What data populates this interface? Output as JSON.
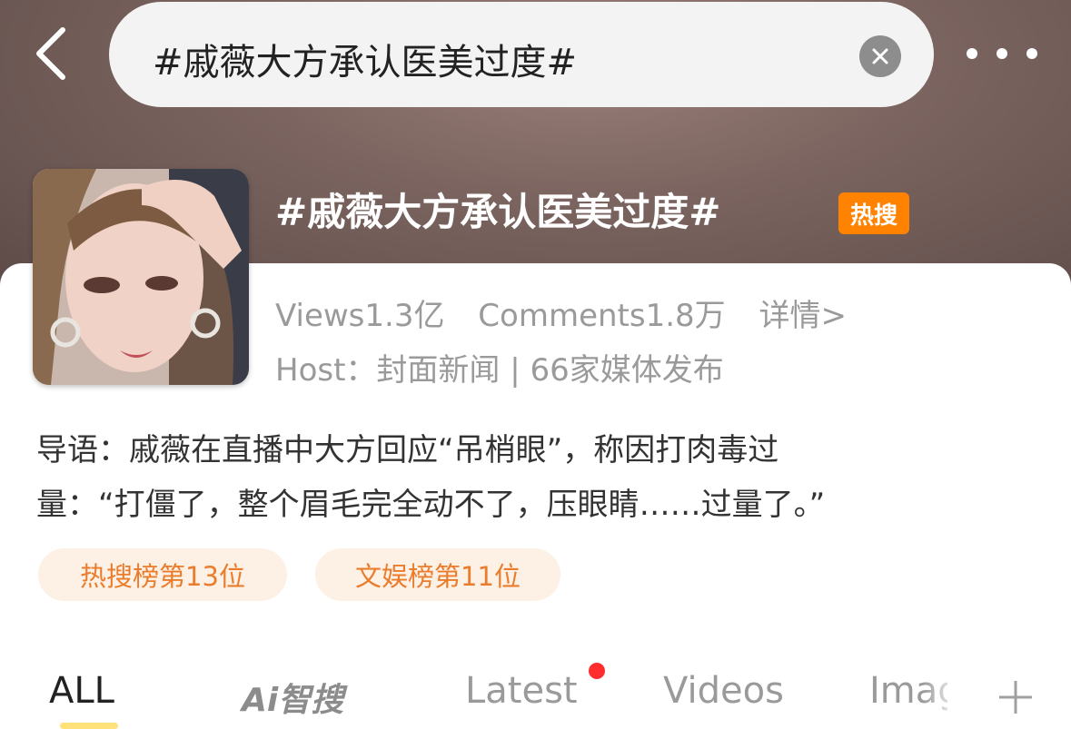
{
  "header": {
    "search_text": "#戚薇大方承认医美过度#",
    "icons": {
      "back": "back-chevron-icon",
      "clear": "clear-x-icon",
      "more": "more-dots-icon"
    }
  },
  "topic": {
    "title": "#戚薇大方承认医美过度#",
    "hot_badge": "热搜",
    "hot_badge_color": "#ff8200",
    "views": "Views1.3亿",
    "comments": "Comments1.8万",
    "details_link": "详情>",
    "host_line": "Host：封面新闻 | 66家媒体发布",
    "intro_line1": "导语：戚薇在直播中大方回应“吊梢眼”，称因打肉毒过",
    "intro_line2": "量：“打僵了，整个眉毛完全动不了，压眼睛……过量了。”",
    "rank_hot": "热搜榜第13位",
    "rank_ent": "文娱榜第11位"
  },
  "tabs": {
    "all": "ALL",
    "ai": "Ai智搜",
    "latest": "Latest",
    "videos": "Videos",
    "images": "Images",
    "add_icon": "plus-icon",
    "active_tab": "ALL",
    "notification_color": "#ff2d2d"
  }
}
